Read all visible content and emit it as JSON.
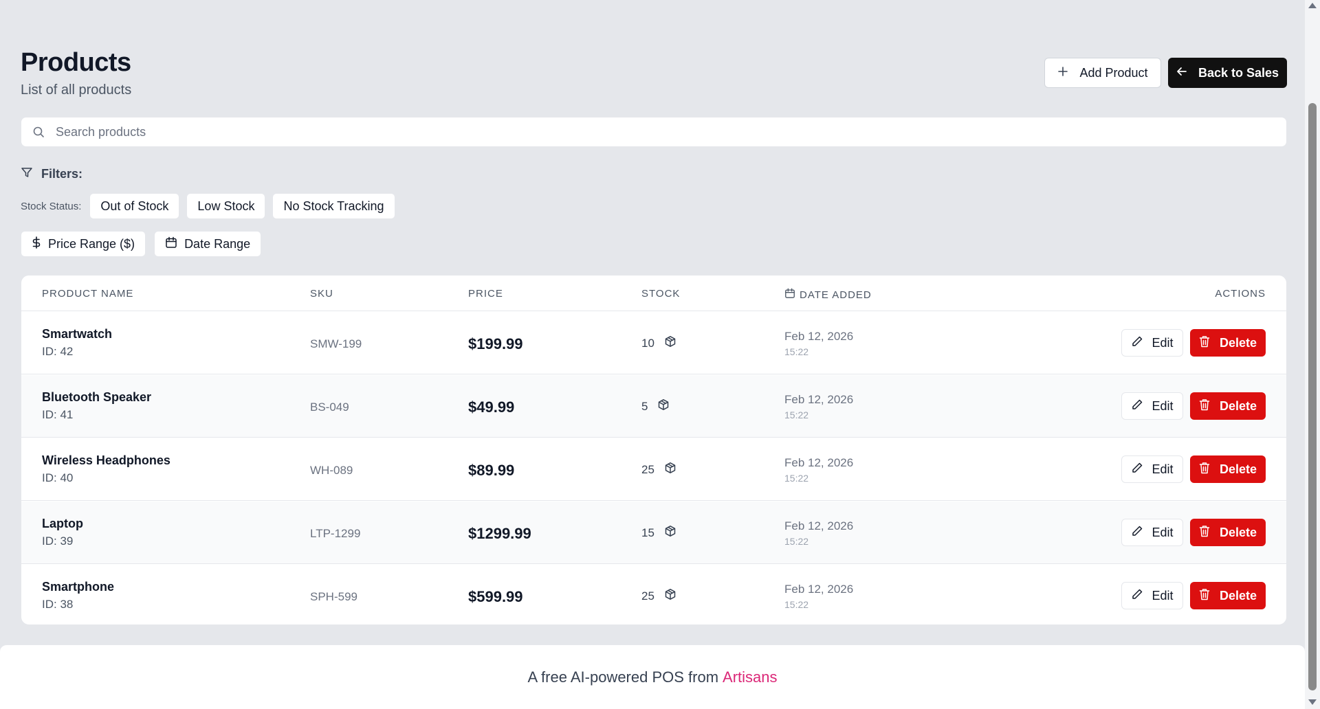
{
  "header": {
    "title": "Products",
    "subtitle": "List of all products",
    "add_label": "Add Product",
    "back_label": "Back to Sales"
  },
  "search": {
    "placeholder": "Search products",
    "value": ""
  },
  "filters": {
    "label": "Filters:",
    "stock_status_label": "Stock Status:",
    "stock_chips": [
      "Out of Stock",
      "Low Stock",
      "No Stock Tracking"
    ],
    "price_range_label": "Price Range ($)",
    "date_range_label": "Date Range"
  },
  "table": {
    "columns": [
      "PRODUCT NAME",
      "SKU",
      "PRICE",
      "STOCK",
      "DATE ADDED",
      "ACTIONS"
    ],
    "edit_label": "Edit",
    "delete_label": "Delete",
    "rows": [
      {
        "name": "Smartwatch",
        "id": "ID: 42",
        "sku": "SMW-199",
        "price": "$199.99",
        "stock": "10",
        "date": "Feb 12, 2026",
        "time": "15:22"
      },
      {
        "name": "Bluetooth Speaker",
        "id": "ID: 41",
        "sku": "BS-049",
        "price": "$49.99",
        "stock": "5",
        "date": "Feb 12, 2026",
        "time": "15:22"
      },
      {
        "name": "Wireless Headphones",
        "id": "ID: 40",
        "sku": "WH-089",
        "price": "$89.99",
        "stock": "25",
        "date": "Feb 12, 2026",
        "time": "15:22"
      },
      {
        "name": "Laptop",
        "id": "ID: 39",
        "sku": "LTP-1299",
        "price": "$1299.99",
        "stock": "15",
        "date": "Feb 12, 2026",
        "time": "15:22"
      },
      {
        "name": "Smartphone",
        "id": "ID: 38",
        "sku": "SPH-599",
        "price": "$599.99",
        "stock": "25",
        "date": "Feb 12, 2026",
        "time": "15:22"
      }
    ]
  },
  "footer": {
    "text": "A free AI-powered POS from",
    "brand": "Artisans"
  },
  "colors": {
    "accent_dark": "#111111",
    "delete_red": "#dc1010",
    "brand_pink": "#db2777",
    "background": "#e5e7eb"
  },
  "icons": [
    "plus-icon",
    "arrow-left-icon",
    "search-icon",
    "filter-icon",
    "dollar-icon",
    "calendar-icon",
    "box-icon",
    "pencil-icon",
    "trash-icon"
  ]
}
